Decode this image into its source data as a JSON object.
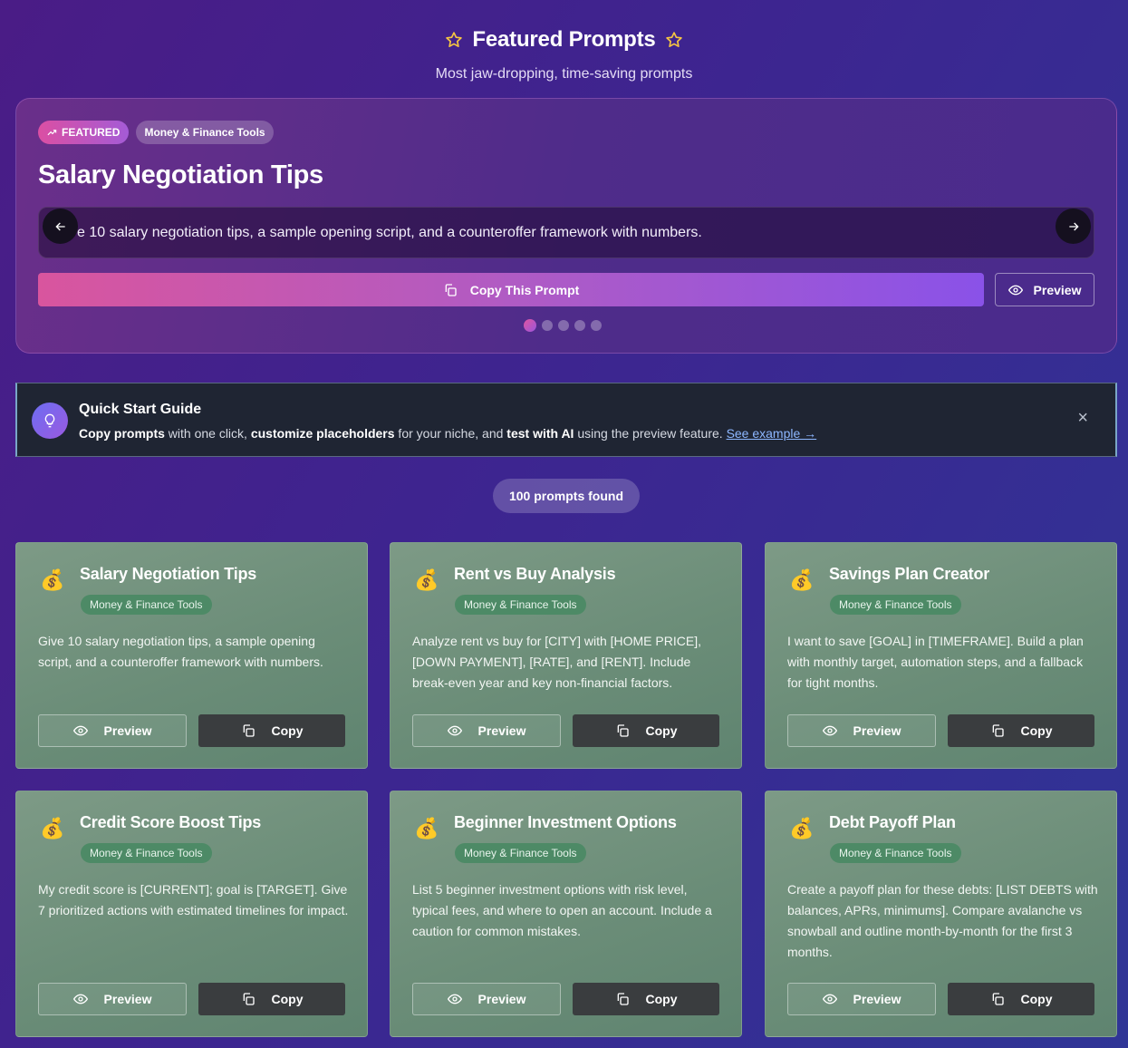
{
  "header": {
    "title": "Featured Prompts",
    "subtitle": "Most jaw-dropping, time-saving prompts"
  },
  "hero": {
    "featured_badge": "FEATURED",
    "category": "Money & Finance Tools",
    "title": "Salary Negotiation Tips",
    "prompt": "Give 10 salary negotiation tips, a sample opening script, and a counteroffer framework with numbers.",
    "copy_label": "Copy This Prompt",
    "preview_label": "Preview",
    "slides_total": 5,
    "active_slide": 1
  },
  "guide": {
    "title": "Quick Start Guide",
    "part1_bold": "Copy prompts",
    "part1": " with one click, ",
    "part2_bold": "customize placeholders",
    "part2": " for your niche, and ",
    "part3_bold": "test with AI",
    "part3": " using the preview feature. ",
    "link": "See example →",
    "close": "×"
  },
  "count_label": "100 prompts found",
  "card_buttons": {
    "preview": "Preview",
    "copy": "Copy"
  },
  "cards": [
    {
      "icon": "💰",
      "title": "Salary Negotiation Tips",
      "tag": "Money & Finance Tools",
      "desc": "Give 10 salary negotiation tips, a sample opening script, and a counteroffer framework with numbers."
    },
    {
      "icon": "💰",
      "title": "Rent vs Buy Analysis",
      "tag": "Money & Finance Tools",
      "desc": "Analyze rent vs buy for [CITY] with [HOME PRICE], [DOWN PAYMENT], [RATE], and [RENT]. Include break-even year and key non-financial factors."
    },
    {
      "icon": "💰",
      "title": "Savings Plan Creator",
      "tag": "Money & Finance Tools",
      "desc": "I want to save [GOAL] in [TIMEFRAME]. Build a plan with monthly target, automation steps, and a fallback for tight months."
    },
    {
      "icon": "💰",
      "title": "Credit Score Boost Tips",
      "tag": "Money & Finance Tools",
      "desc": "My credit score is [CURRENT]; goal is [TARGET]. Give 7 prioritized actions with estimated timelines for impact."
    },
    {
      "icon": "💰",
      "title": "Beginner Investment Options",
      "tag": "Money & Finance Tools",
      "desc": "List 5 beginner investment options with risk level, typical fees, and where to open an account. Include a caution for common mistakes."
    },
    {
      "icon": "💰",
      "title": "Debt Payoff Plan",
      "tag": "Money & Finance Tools",
      "desc": "Create a payoff plan for these debts: [LIST DEBTS with balances, APRs, minimums]. Compare avalanche vs snowball and outline month-by-month for the first 3 months."
    }
  ]
}
